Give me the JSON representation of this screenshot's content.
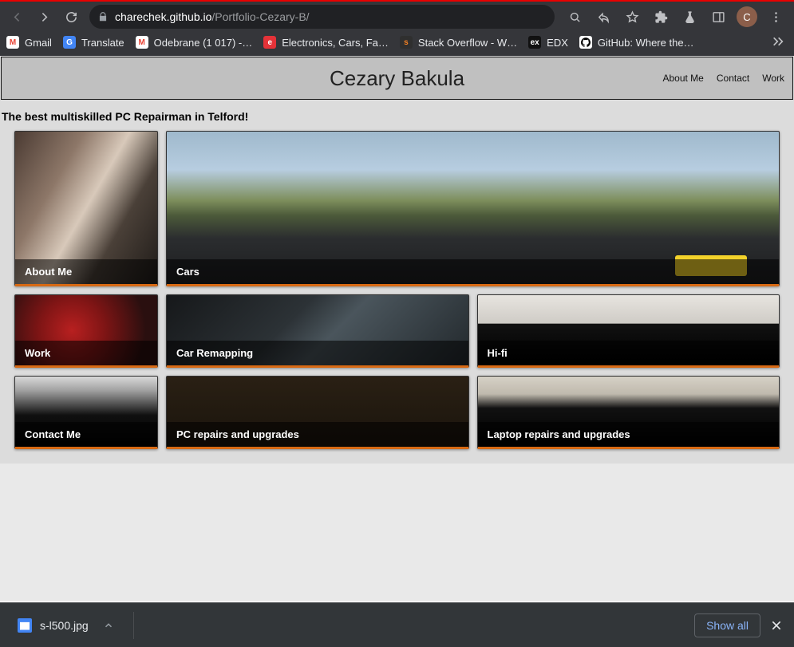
{
  "browser": {
    "url_host": "charechek.github.io",
    "url_path": "/Portfolio-Cezary-B/",
    "avatar_initial": "C"
  },
  "bookmarks": [
    {
      "label": "Gmail",
      "favi_bg": "#ffffff",
      "favi_fg": "#ea4335",
      "favi_txt": "M"
    },
    {
      "label": "Translate",
      "favi_bg": "#4285f4",
      "favi_fg": "#ffffff",
      "favi_txt": "G"
    },
    {
      "label": "Odebrane (1 017) -…",
      "favi_bg": "#ffffff",
      "favi_fg": "#ea4335",
      "favi_txt": "M"
    },
    {
      "label": "Electronics, Cars, Fa…",
      "favi_bg": "#0064d2",
      "favi_fg": "#f5af02",
      "favi_txt": "e"
    },
    {
      "label": "Stack Overflow - W…",
      "favi_bg": "#2f2f2f",
      "favi_fg": "#f48024",
      "favi_txt": "s"
    },
    {
      "label": "EDX",
      "favi_bg": "#111111",
      "favi_fg": "#ffffff",
      "favi_txt": "ex"
    },
    {
      "label": "GitHub: Where the…",
      "favi_bg": "#ffffff",
      "favi_fg": "#000000",
      "favi_txt": ""
    }
  ],
  "page": {
    "title": "Cezary Bakula",
    "nav": [
      "About Me",
      "Contact",
      "Work"
    ],
    "tagline": "The best multiskilled PC Repairman in Telford!",
    "tiles": {
      "about": "About Me",
      "cars": "Cars",
      "work": "Work",
      "remap": "Car Remapping",
      "hifi": "Hi-fi",
      "contact": "Contact Me",
      "pc": "PC repairs and upgrades",
      "laptop": "Laptop repairs and upgrades"
    }
  },
  "download": {
    "filename": "s-l500.jpg",
    "show_all": "Show all"
  }
}
